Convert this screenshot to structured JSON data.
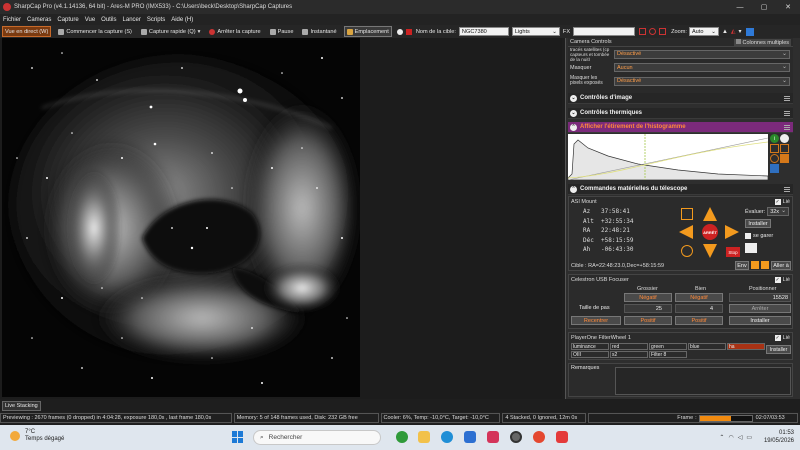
{
  "titlebar": {
    "title": "SharpCap Pro (v4.1.14136, 64 bit) - Ares-M PRO (IMX533) - C:\\Users\\beck\\Desktop\\SharpCap Captures",
    "minimize": "—",
    "maximize": "▢",
    "close": "✕"
  },
  "menu": [
    "Fichier",
    "Cameras",
    "Capture",
    "Vue",
    "Outils",
    "Lancer",
    "Scripts",
    "Aide (H)"
  ],
  "toolbar": {
    "live_view": "Vue en direct (W)",
    "start_capture": "Commencer la capture (S)",
    "quick_capture": "Capture rapide (Q)",
    "stop_capture": "Arrêter la capture",
    "pause": "Pause",
    "snapshot": "Instantané",
    "placement": "Emplacement",
    "target_label": "Nom de la cible:",
    "target_value": "NGC7380",
    "frame_type": "Lights",
    "fx_label": "FX",
    "fx_value": "",
    "zoom_label": "Zoom:",
    "zoom_value": "Auto"
  },
  "camera_controls": {
    "header": "Camera Controls",
    "multi_cols": "Colonnes multiples",
    "rows": [
      {
        "label": "tracés satellites (cp capteurs et tombée de la nuit)",
        "value": "Désactivé"
      },
      {
        "label": "Masquer",
        "value": "Aucun"
      },
      {
        "label": "Masquer les pixels exposés",
        "value": "Désactivé"
      }
    ]
  },
  "sections": {
    "image_controls": "Contrôles d'image",
    "thermal_controls": "Contrôles thermiques",
    "histogram": "Afficher l'étirement de l'histogramme",
    "telescope": "Commandes matérielles du télescope"
  },
  "mount": {
    "name": "ASI Mount",
    "live_label": "Lié",
    "az": "37:58:41",
    "alt": "+32:55:34",
    "ra": "22:48:21",
    "dec": "+58:15:59",
    "ah": "-06:43:30",
    "az_label": "Az",
    "alt_label": "Alt",
    "ra_label": "RA",
    "dec_label": "Déc",
    "ah_label": "Ah",
    "rate_label": "Évaluer:",
    "rate_value": "32x",
    "install_label": "Installer",
    "park_label": "se garer",
    "stop_label": "Stop",
    "center_label": "ARRÊT",
    "target_text": "Cible : RA=22:48:23.0,Dec=+58:15:59",
    "env_label": "Env",
    "goto_label": "Aller à"
  },
  "focuser": {
    "name": "Celestron USB Focuser",
    "live_label": "Lié",
    "coarse": "Grossier",
    "fine": "Bien",
    "position": "Positionner",
    "neg1": "Négatif",
    "neg2": "Négatif",
    "position_value": "15528",
    "step_label": "Taille de pas",
    "step_coarse": "25",
    "step_fine": "4",
    "stop": "Arrêter",
    "back": "Recentrer",
    "pos1": "Positif",
    "pos2": "Positif",
    "install": "Installer"
  },
  "filterwheel": {
    "name": "PlayerOne FilterWheel 1",
    "live_label": "Lié",
    "filters_row1": [
      "luminance",
      "red",
      "green",
      "blue",
      "ha"
    ],
    "filters_row2": [
      "OIII",
      "s2",
      "Filter 8"
    ],
    "install": "Installer"
  },
  "remarks": {
    "label": "Remarques"
  },
  "live_stacking": "Live Stacking",
  "status": {
    "previewing": "Previewing : 2670 frames (0 dropped) in 4:04:28, exposure 180,0s , last frame 180,0s",
    "memory": "Memory: 5 of 148 frames used, Disk: 232 GB free",
    "cooler": "Cooler: 6%, Temp: -10,0°C, Target: -10,0°C",
    "stack": "4 Stacked, 0 Ignored, 12m 0s",
    "frame_label": "Frame",
    "frame_time": "02:07/03:53",
    "frame_progress": 0.61
  },
  "taskbar": {
    "temp": "7°C",
    "weather": "Temps dégagé",
    "search": "Rechercher",
    "time": "01:53",
    "date": "19/05/2026"
  },
  "colors": {
    "accent": "#ff8a3a",
    "active_bg": "#7a3a10",
    "histogram_header": "#7b2a7b",
    "arrow": "#f39a1e",
    "filter_selected": "#a83214"
  }
}
